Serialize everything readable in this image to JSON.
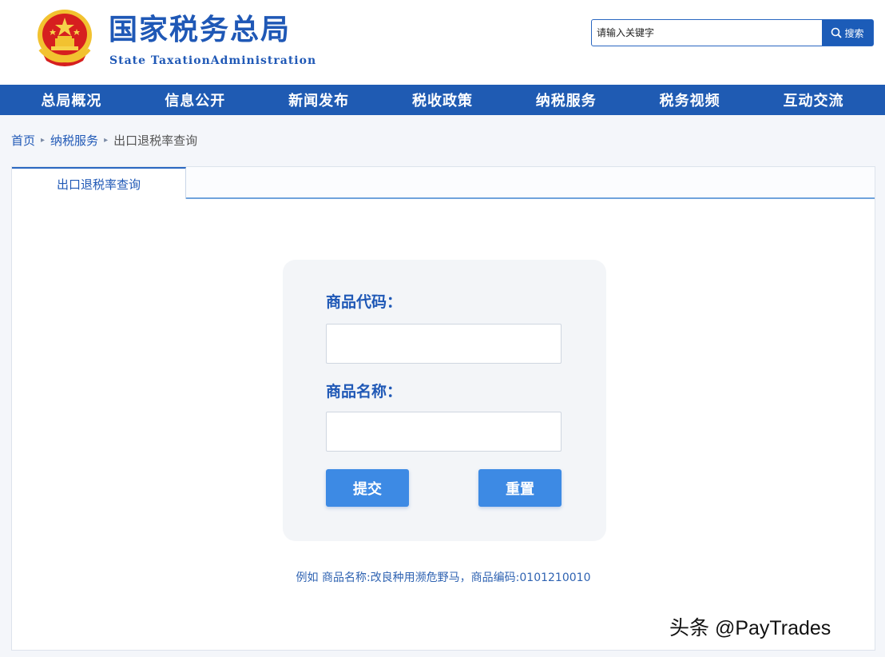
{
  "header": {
    "title": "国家税务总局",
    "subtitle": "State TaxationAdministration",
    "emblem_icon": "national-emblem-icon"
  },
  "search": {
    "placeholder": "请输入关键字",
    "button_label": "搜索",
    "icon": "search-icon"
  },
  "nav": {
    "items": [
      {
        "label": "总局概况"
      },
      {
        "label": "信息公开"
      },
      {
        "label": "新闻发布"
      },
      {
        "label": "税收政策"
      },
      {
        "label": "纳税服务"
      },
      {
        "label": "税务视频"
      },
      {
        "label": "互动交流"
      }
    ]
  },
  "breadcrumb": {
    "home": "首页",
    "section": "纳税服务",
    "current": "出口退税率查询"
  },
  "tabs": {
    "active": "出口退税率查询"
  },
  "form": {
    "code_label": "商品代码：",
    "code_value": "",
    "name_label": "商品名称：",
    "name_value": "",
    "submit_label": "提交",
    "reset_label": "重置"
  },
  "example": "例如 商品名称:改良种用濒危野马，商品编码:0101210010",
  "watermark": "头条 @PayTrades",
  "colors": {
    "brand_blue": "#1f5bb3",
    "button_blue": "#3d8ae4",
    "emblem_red": "#d61f1f",
    "emblem_gold": "#f2c230"
  }
}
